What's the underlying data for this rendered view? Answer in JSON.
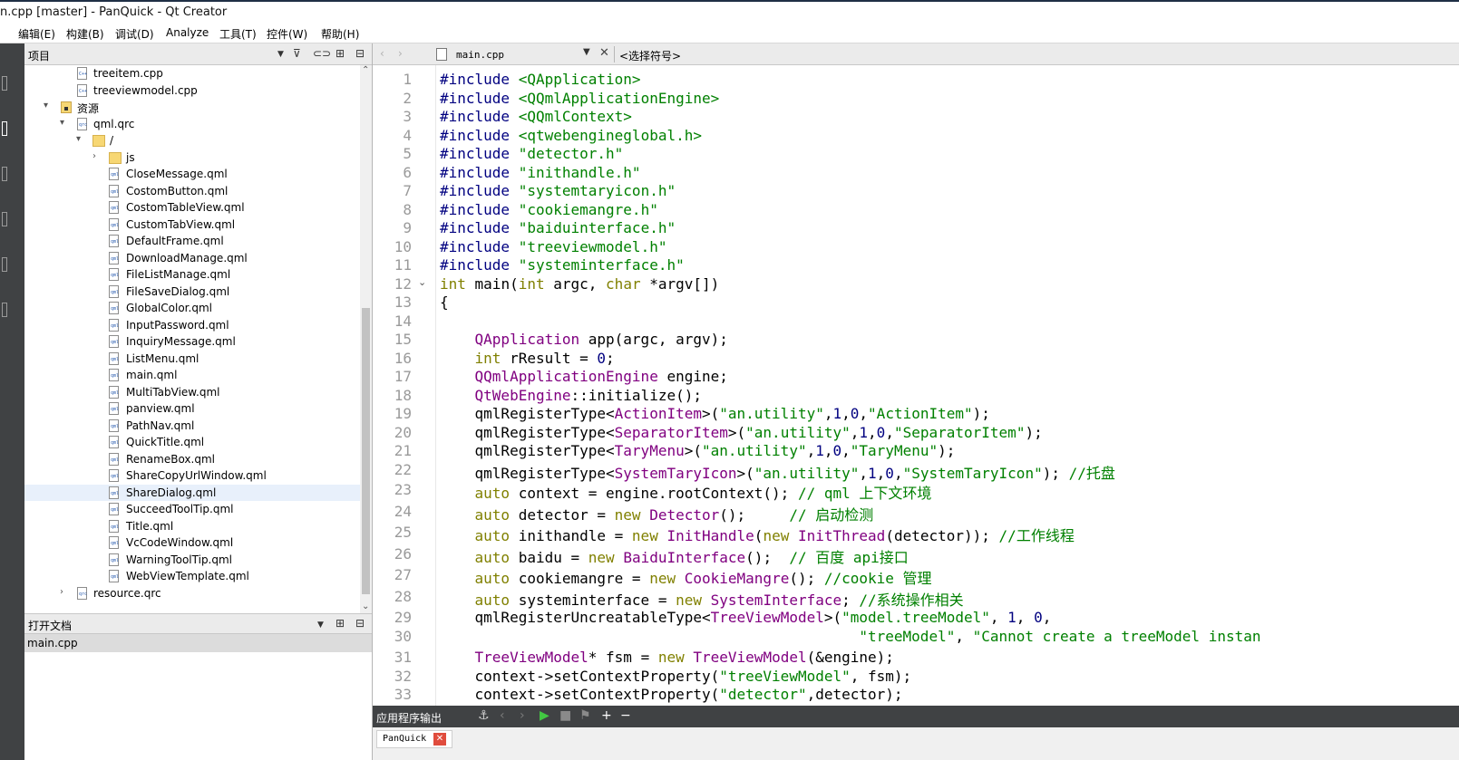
{
  "window": {
    "title": "n.cpp [master] - PanQuick - Qt Creator"
  },
  "menu": {
    "items": [
      "",
      "编辑(E)",
      "构建(B)",
      "调试(D)",
      "Analyze",
      "工具(T)",
      "控件(W)",
      "帮助(H)"
    ]
  },
  "project_pane": {
    "title": "项目",
    "tree": [
      "treeitem.cpp",
      "treeviewmodel.cpp",
      "资源",
      "qml.qrc",
      "/",
      "js",
      "CloseMessage.qml",
      "CostomButton.qml",
      "CostomTableView.qml",
      "CustomTabView.qml",
      "DefaultFrame.qml",
      "DownloadManage.qml",
      "FileListManage.qml",
      "FileSaveDialog.qml",
      "GlobalColor.qml",
      "InputPassword.qml",
      "InquiryMessage.qml",
      "ListMenu.qml",
      "main.qml",
      "MultiTabView.qml",
      "panview.qml",
      "PathNav.qml",
      "QuickTitle.qml",
      "RenameBox.qml",
      "ShareCopyUrlWindow.qml",
      "ShareDialog.qml",
      "SucceedToolTip.qml",
      "Title.qml",
      "VcCodeWindow.qml",
      "WarningToolTip.qml",
      "WebViewTemplate.qml",
      "resource.qrc"
    ],
    "selected": "ShareDialog.qml"
  },
  "open_documents": {
    "title": "打开文档",
    "items": [
      "main.cpp"
    ]
  },
  "editor": {
    "file_name": "main.cpp",
    "symbol_placeholder": "<选择符号>",
    "line_numbers": [
      "1",
      "2",
      "3",
      "4",
      "5",
      "6",
      "7",
      "8",
      "9",
      "10",
      "11",
      "12",
      "13",
      "14",
      "15",
      "16",
      "17",
      "18",
      "19",
      "20",
      "21",
      "22",
      "23",
      "24",
      "25",
      "26",
      "27",
      "28",
      "29",
      "30",
      "31",
      "32",
      "33"
    ]
  },
  "output": {
    "title": "应用程序输出",
    "tab": "PanQuick"
  },
  "colors": {
    "mode_bar": "#404244",
    "pane_header": "#ebebeb",
    "include": "#000080",
    "string": "#008000",
    "type": "#800080",
    "keyword": "#808000",
    "comment": "#008000"
  }
}
